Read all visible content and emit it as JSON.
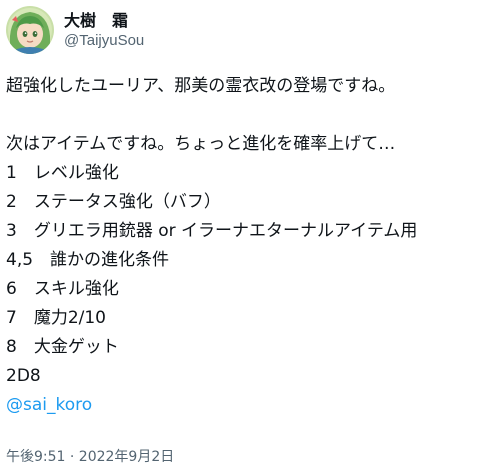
{
  "author": {
    "display_name": "大樹　霜",
    "handle": "@TaijyuSou",
    "avatar_icon": "avatar-anime-character-icon"
  },
  "tweet": {
    "line1": "超強化したユーリア、那美の霊衣改の登場ですね。",
    "line2": "次はアイテムですね。ちょっと進化を確率上げて…",
    "list": [
      "1　レベル強化",
      "2　ステータス強化（バフ）",
      "3　グリエラ用銃器 or イラーナエターナルアイテム用",
      "4,5　誰かの進化条件",
      "6　スキル強化",
      "7　魔力2/10",
      "8　大金ゲット"
    ],
    "dice": "2D8",
    "mention": "@sai_koro"
  },
  "meta": {
    "timestamp": "午後9:51 · 2022年9月2日"
  },
  "colors": {
    "text": "#0f1419",
    "secondary": "#536471",
    "link": "#1d9bf0"
  }
}
